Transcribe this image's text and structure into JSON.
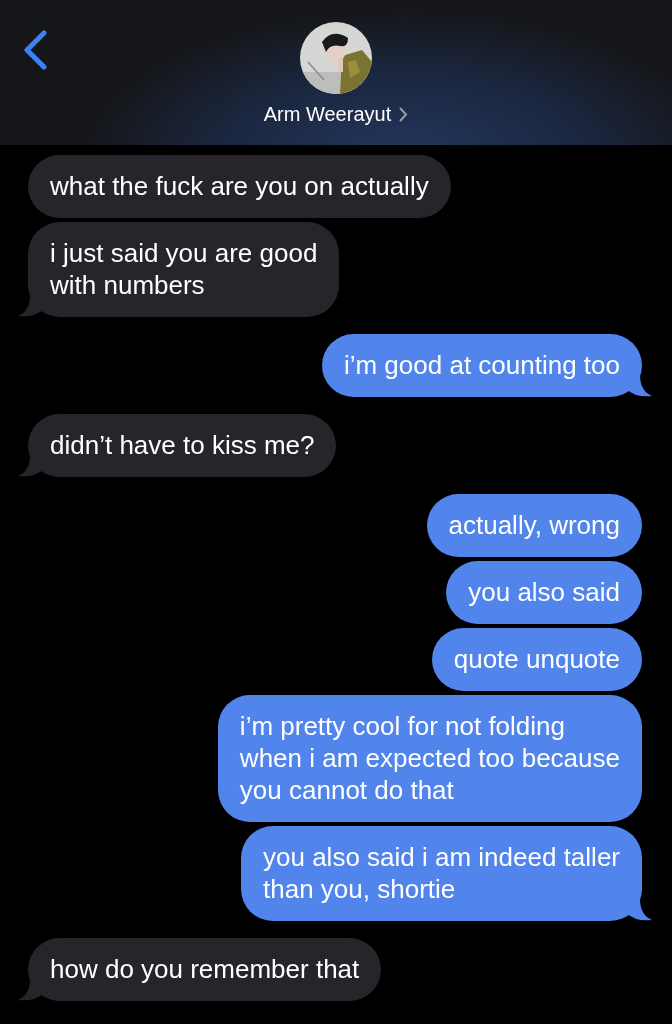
{
  "header": {
    "contact_name": "Arm Weerayut"
  },
  "messages": [
    {
      "kind": "incoming",
      "text": "what the fuck are you on actually",
      "tail": false
    },
    {
      "kind": "incoming",
      "text": "i just said you are good\nwith numbers",
      "tail": true
    },
    {
      "kind": "outgoing",
      "text": "i’m good at counting too",
      "tail": true
    },
    {
      "kind": "incoming",
      "text": "didn’t have to kiss me?",
      "tail": true
    },
    {
      "kind": "outgoing",
      "text": "actually, wrong",
      "tail": false
    },
    {
      "kind": "outgoing",
      "text": "you also said",
      "tail": false
    },
    {
      "kind": "outgoing",
      "text": "quote unquote",
      "tail": false
    },
    {
      "kind": "outgoing",
      "text": "i’m pretty cool for not folding\nwhen i am expected too because\nyou cannot do that",
      "tail": false
    },
    {
      "kind": "outgoing",
      "text": "you also said i am indeed taller\nthan you, shortie",
      "tail": true
    },
    {
      "kind": "incoming",
      "text": "how do you remember that",
      "tail": true
    }
  ]
}
